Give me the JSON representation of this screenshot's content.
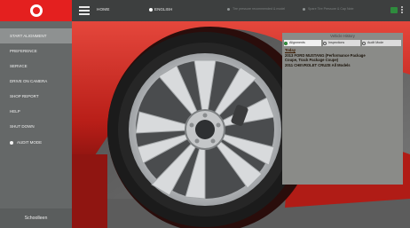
{
  "header": {
    "home_label": "HOME",
    "language": "ENGLISH",
    "status1": "Tire pressure recommended & model",
    "status2": "Spare Tire Pressure & Cap Note"
  },
  "sidebar": {
    "items": [
      {
        "label": "START ALIGNMENT",
        "active": true
      },
      {
        "label": "PREFERENCE",
        "active": false
      },
      {
        "label": "SERVICE",
        "active": false
      },
      {
        "label": "DRIVE ON CAMERA",
        "active": false
      },
      {
        "label": "SHOP REPORT",
        "active": false
      },
      {
        "label": "HELP",
        "active": false
      },
      {
        "label": "SHUT DOWN",
        "active": false
      }
    ],
    "radio_label": "AUDIT MODE",
    "footer": "Schoolleen"
  },
  "panel": {
    "title": "Vehicle History",
    "tabs": [
      {
        "label": "Alignments",
        "selected": true
      },
      {
        "label": "Inspections",
        "selected": false
      },
      {
        "label": "Audit Mode",
        "selected": false
      }
    ],
    "section": "Today",
    "entries": [
      "2013 FORD MUSTANG (Performance Package",
      "Coupe, Track Package Coupe)",
      "2011 CHEVROLET CRUZE All Models"
    ]
  },
  "colors": {
    "brand_red": "#e4201f",
    "topbar": "#3d3f3f",
    "sidebar": "#656868",
    "panel": "#8a8b88",
    "car_red": "#c0201a"
  }
}
